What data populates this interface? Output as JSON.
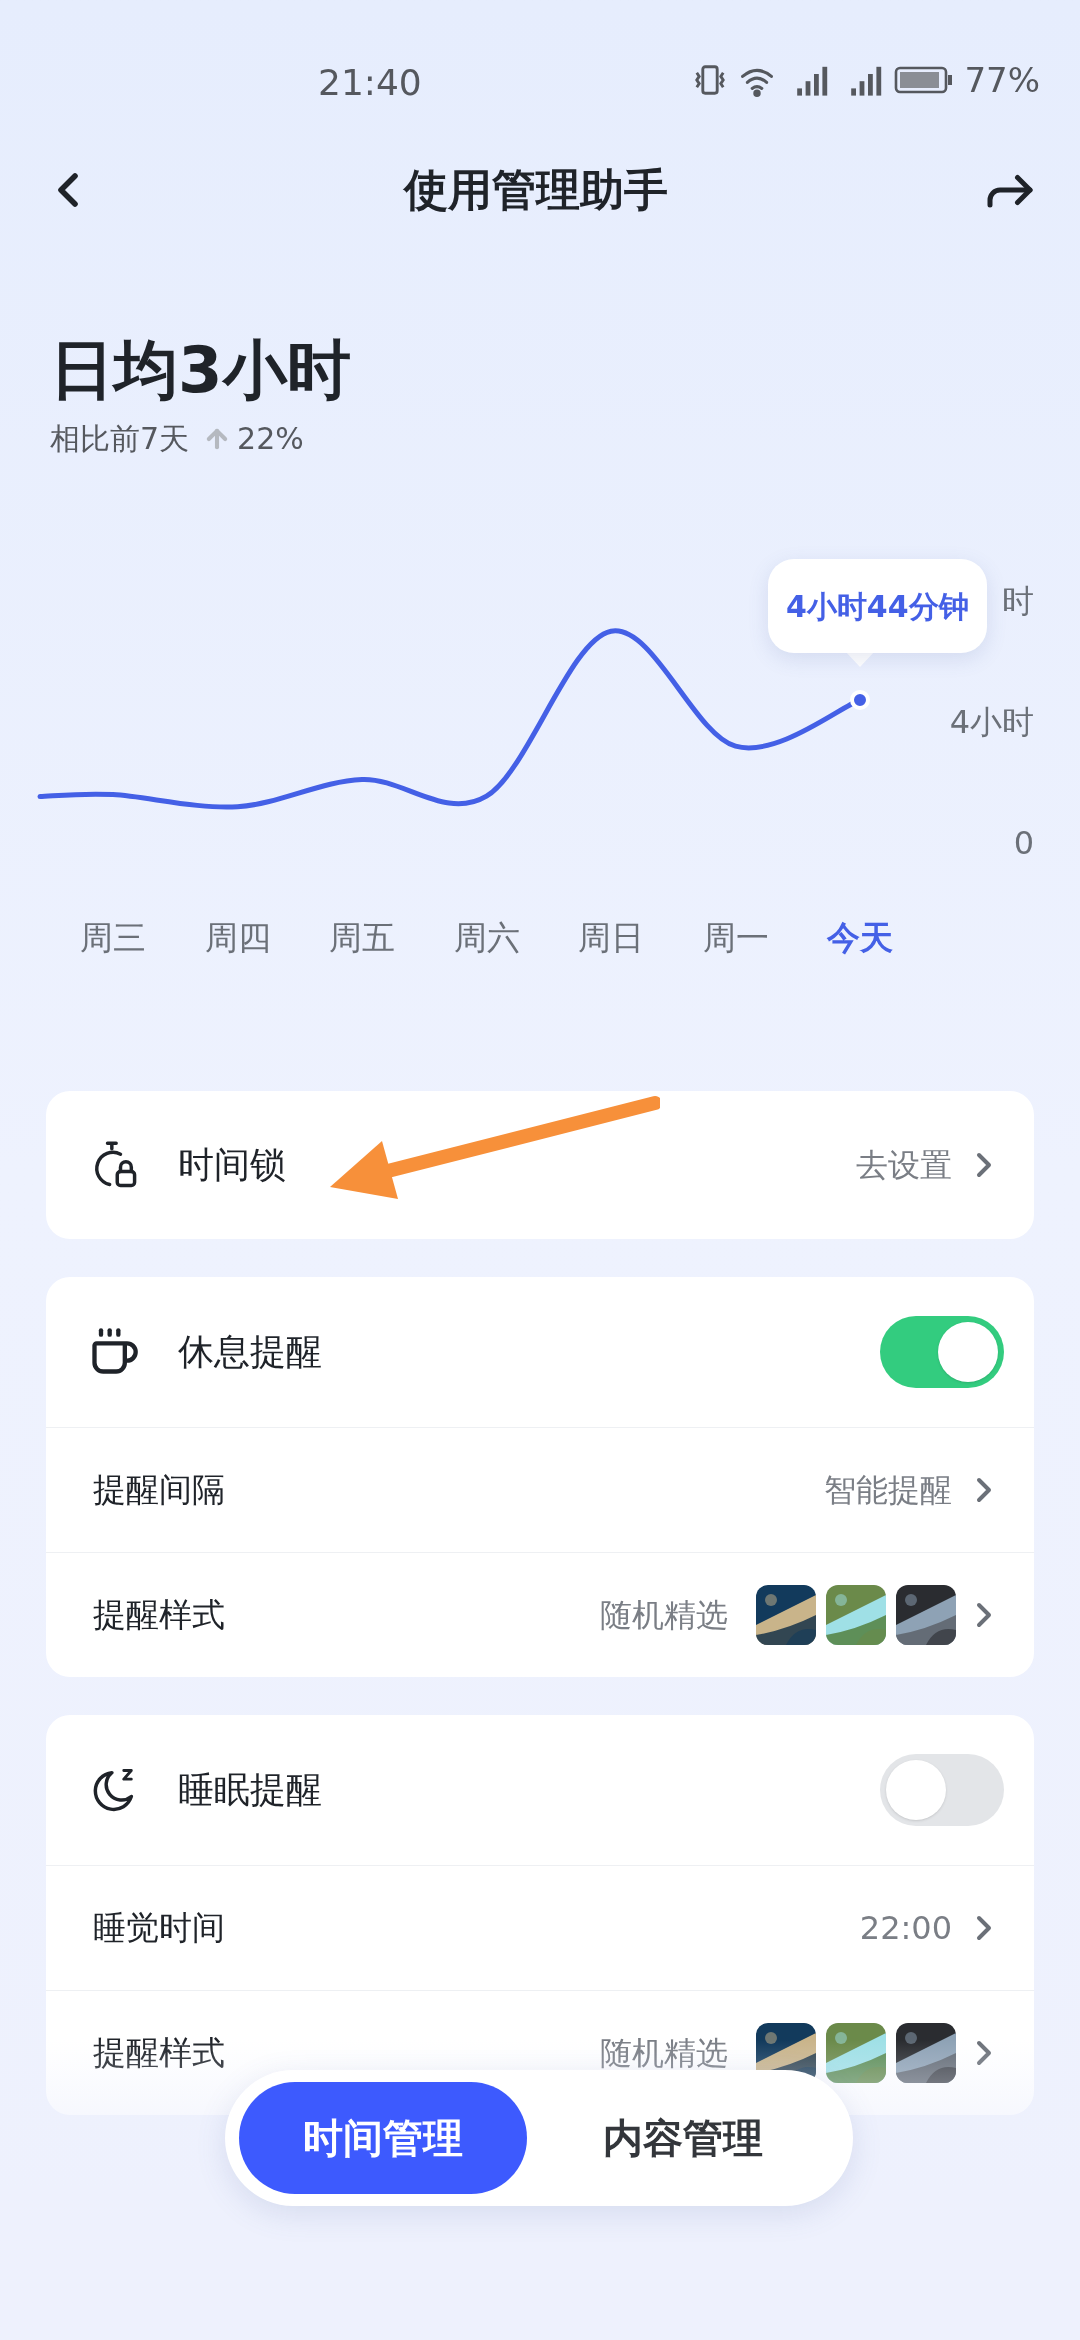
{
  "status_bar": {
    "time": "21:40",
    "battery": "77%"
  },
  "header": {
    "title": "使用管理助手"
  },
  "summary": {
    "headline": "日均3小时",
    "compare_label": "相比前7天",
    "change": "22%"
  },
  "usage_chart": {
    "chart_data": {
      "type": "line",
      "categories": [
        "周三",
        "周四",
        "周五",
        "周六",
        "周日",
        "周一",
        "今天"
      ],
      "series": [
        {
          "color": "#4460e6",
          "values": [
            1.6,
            1.2,
            2.1,
            1.55,
            7.0,
            3.2,
            4.73
          ]
        }
      ],
      "ylim": [
        0,
        8
      ],
      "yticks": [
        {
          "value": 0,
          "label": "0"
        },
        {
          "value": 4,
          "label": "4小时"
        },
        {
          "value": 8,
          "label": "时"
        }
      ],
      "annotations": [
        {
          "text": "4小时44分钟",
          "x": "今天",
          "y": 4.73
        }
      ]
    }
  },
  "time_lock": {
    "label": "时间锁",
    "action": "去设置"
  },
  "rest_reminder": {
    "label": "休息提醒",
    "on": true,
    "rows": [
      {
        "kind": "value",
        "label": "提醒间隔",
        "value": "智能提醒"
      },
      {
        "kind": "pictures",
        "label": "提醒样式",
        "value": "随机精选"
      }
    ]
  },
  "sleep_reminder": {
    "label": "睡眠提醒",
    "on": false,
    "rows": [
      {
        "kind": "value",
        "label": "睡觉时间",
        "value": "22:00"
      },
      {
        "kind": "pictures",
        "label": "提醒样式",
        "value": "随机精选"
      }
    ]
  },
  "bottom_tabs": [
    {
      "label": "时间管理",
      "selected": true
    },
    {
      "label": "内容管理",
      "selected": false
    }
  ]
}
